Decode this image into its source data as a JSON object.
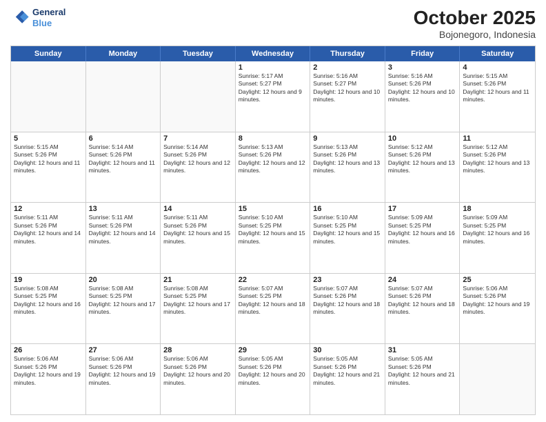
{
  "header": {
    "logo_line1": "General",
    "logo_line2": "Blue",
    "month_title": "October 2025",
    "subtitle": "Bojonegoro, Indonesia"
  },
  "day_headers": [
    "Sunday",
    "Monday",
    "Tuesday",
    "Wednesday",
    "Thursday",
    "Friday",
    "Saturday"
  ],
  "weeks": [
    [
      {
        "day": "",
        "empty": true
      },
      {
        "day": "",
        "empty": true
      },
      {
        "day": "",
        "empty": true
      },
      {
        "day": "1",
        "sunrise": "5:17 AM",
        "sunset": "5:27 PM",
        "daylight": "12 hours and 9 minutes."
      },
      {
        "day": "2",
        "sunrise": "5:16 AM",
        "sunset": "5:27 PM",
        "daylight": "12 hours and 10 minutes."
      },
      {
        "day": "3",
        "sunrise": "5:16 AM",
        "sunset": "5:26 PM",
        "daylight": "12 hours and 10 minutes."
      },
      {
        "day": "4",
        "sunrise": "5:15 AM",
        "sunset": "5:26 PM",
        "daylight": "12 hours and 11 minutes."
      }
    ],
    [
      {
        "day": "5",
        "sunrise": "5:15 AM",
        "sunset": "5:26 PM",
        "daylight": "12 hours and 11 minutes."
      },
      {
        "day": "6",
        "sunrise": "5:14 AM",
        "sunset": "5:26 PM",
        "daylight": "12 hours and 11 minutes."
      },
      {
        "day": "7",
        "sunrise": "5:14 AM",
        "sunset": "5:26 PM",
        "daylight": "12 hours and 12 minutes."
      },
      {
        "day": "8",
        "sunrise": "5:13 AM",
        "sunset": "5:26 PM",
        "daylight": "12 hours and 12 minutes."
      },
      {
        "day": "9",
        "sunrise": "5:13 AM",
        "sunset": "5:26 PM",
        "daylight": "12 hours and 13 minutes."
      },
      {
        "day": "10",
        "sunrise": "5:12 AM",
        "sunset": "5:26 PM",
        "daylight": "12 hours and 13 minutes."
      },
      {
        "day": "11",
        "sunrise": "5:12 AM",
        "sunset": "5:26 PM",
        "daylight": "12 hours and 13 minutes."
      }
    ],
    [
      {
        "day": "12",
        "sunrise": "5:11 AM",
        "sunset": "5:26 PM",
        "daylight": "12 hours and 14 minutes."
      },
      {
        "day": "13",
        "sunrise": "5:11 AM",
        "sunset": "5:26 PM",
        "daylight": "12 hours and 14 minutes."
      },
      {
        "day": "14",
        "sunrise": "5:11 AM",
        "sunset": "5:26 PM",
        "daylight": "12 hours and 15 minutes."
      },
      {
        "day": "15",
        "sunrise": "5:10 AM",
        "sunset": "5:25 PM",
        "daylight": "12 hours and 15 minutes."
      },
      {
        "day": "16",
        "sunrise": "5:10 AM",
        "sunset": "5:25 PM",
        "daylight": "12 hours and 15 minutes."
      },
      {
        "day": "17",
        "sunrise": "5:09 AM",
        "sunset": "5:25 PM",
        "daylight": "12 hours and 16 minutes."
      },
      {
        "day": "18",
        "sunrise": "5:09 AM",
        "sunset": "5:25 PM",
        "daylight": "12 hours and 16 minutes."
      }
    ],
    [
      {
        "day": "19",
        "sunrise": "5:08 AM",
        "sunset": "5:25 PM",
        "daylight": "12 hours and 16 minutes."
      },
      {
        "day": "20",
        "sunrise": "5:08 AM",
        "sunset": "5:25 PM",
        "daylight": "12 hours and 17 minutes."
      },
      {
        "day": "21",
        "sunrise": "5:08 AM",
        "sunset": "5:25 PM",
        "daylight": "12 hours and 17 minutes."
      },
      {
        "day": "22",
        "sunrise": "5:07 AM",
        "sunset": "5:25 PM",
        "daylight": "12 hours and 18 minutes."
      },
      {
        "day": "23",
        "sunrise": "5:07 AM",
        "sunset": "5:26 PM",
        "daylight": "12 hours and 18 minutes."
      },
      {
        "day": "24",
        "sunrise": "5:07 AM",
        "sunset": "5:26 PM",
        "daylight": "12 hours and 18 minutes."
      },
      {
        "day": "25",
        "sunrise": "5:06 AM",
        "sunset": "5:26 PM",
        "daylight": "12 hours and 19 minutes."
      }
    ],
    [
      {
        "day": "26",
        "sunrise": "5:06 AM",
        "sunset": "5:26 PM",
        "daylight": "12 hours and 19 minutes."
      },
      {
        "day": "27",
        "sunrise": "5:06 AM",
        "sunset": "5:26 PM",
        "daylight": "12 hours and 19 minutes."
      },
      {
        "day": "28",
        "sunrise": "5:06 AM",
        "sunset": "5:26 PM",
        "daylight": "12 hours and 20 minutes."
      },
      {
        "day": "29",
        "sunrise": "5:05 AM",
        "sunset": "5:26 PM",
        "daylight": "12 hours and 20 minutes."
      },
      {
        "day": "30",
        "sunrise": "5:05 AM",
        "sunset": "5:26 PM",
        "daylight": "12 hours and 21 minutes."
      },
      {
        "day": "31",
        "sunrise": "5:05 AM",
        "sunset": "5:26 PM",
        "daylight": "12 hours and 21 minutes."
      },
      {
        "day": "",
        "empty": true
      }
    ]
  ]
}
